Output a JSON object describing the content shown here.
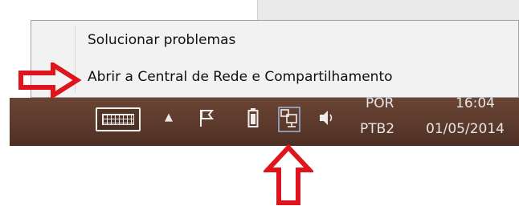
{
  "context_menu": {
    "items": [
      {
        "label": "Solucionar problemas"
      },
      {
        "label": "Abrir a Central de Rede e Compartilhamento"
      }
    ]
  },
  "tray": {
    "icons": [
      "keyboard-icon",
      "chevron-up-icon",
      "flag-icon",
      "battery-icon",
      "network-icon",
      "speaker-icon"
    ],
    "language": "POR",
    "keyboard_layout": "PTB2",
    "time": "16:04",
    "date": "01/05/2014"
  },
  "annotations": {
    "arrow_color": "#e0141c"
  },
  "colors": {
    "taskbar": "#5c3a2c",
    "menu_background": "#f2f2f2"
  }
}
